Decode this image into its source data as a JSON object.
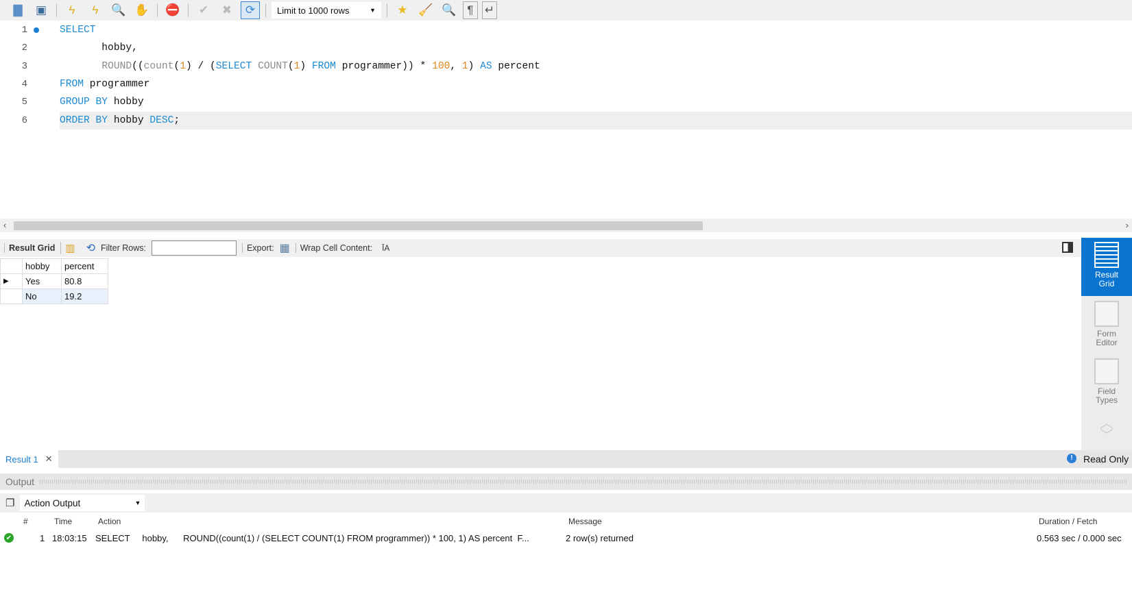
{
  "toolbar": {
    "limit_label": "Limit to 1000 rows",
    "icons": [
      "open-folder-icon",
      "save-icon",
      "execute-icon",
      "execute-current-icon",
      "explain-icon",
      "stop-icon",
      "toggle-error-icon",
      "commit-icon",
      "rollback-icon",
      "autocommit-icon",
      "add-snippet-icon",
      "beautify-icon",
      "find-icon",
      "invisible-chars-icon",
      "wrap-icon"
    ]
  },
  "editor": {
    "lines": [
      {
        "n": "1",
        "tokens": [
          {
            "t": "SELECT",
            "c": "kw"
          }
        ]
      },
      {
        "n": "2",
        "tokens": [
          {
            "t": "       hobby,",
            "c": "id"
          }
        ]
      },
      {
        "n": "3",
        "tokens": [
          {
            "t": "       ",
            "c": "id"
          },
          {
            "t": "ROUND",
            "c": "fn"
          },
          {
            "t": "((",
            "c": "id"
          },
          {
            "t": "count",
            "c": "fn"
          },
          {
            "t": "(",
            "c": "id"
          },
          {
            "t": "1",
            "c": "num"
          },
          {
            "t": ") / (",
            "c": "id"
          },
          {
            "t": "SELECT",
            "c": "kw"
          },
          {
            "t": " ",
            "c": "id"
          },
          {
            "t": "COUNT",
            "c": "fn"
          },
          {
            "t": "(",
            "c": "id"
          },
          {
            "t": "1",
            "c": "num"
          },
          {
            "t": ") ",
            "c": "id"
          },
          {
            "t": "FROM",
            "c": "kw"
          },
          {
            "t": " programmer)) * ",
            "c": "id"
          },
          {
            "t": "100",
            "c": "num"
          },
          {
            "t": ", ",
            "c": "id"
          },
          {
            "t": "1",
            "c": "num"
          },
          {
            "t": ") ",
            "c": "id"
          },
          {
            "t": "AS",
            "c": "kw"
          },
          {
            "t": " percent",
            "c": "id"
          }
        ]
      },
      {
        "n": "4",
        "tokens": [
          {
            "t": "FROM",
            "c": "kw"
          },
          {
            "t": " programmer",
            "c": "id"
          }
        ]
      },
      {
        "n": "5",
        "tokens": [
          {
            "t": "GROUP BY",
            "c": "kw"
          },
          {
            "t": " hobby",
            "c": "id"
          }
        ]
      },
      {
        "n": "6",
        "tokens": [
          {
            "t": "ORDER BY",
            "c": "kw"
          },
          {
            "t": " hobby ",
            "c": "id"
          },
          {
            "t": "DESC",
            "c": "kw"
          },
          {
            "t": ";",
            "c": "id"
          }
        ]
      }
    ]
  },
  "results": {
    "result_grid_label": "Result Grid",
    "filter_label": "Filter Rows:",
    "filter_value": "",
    "export_label": "Export:",
    "wrap_label": "Wrap Cell Content:",
    "columns": [
      "hobby",
      "percent"
    ],
    "rows": [
      [
        "Yes",
        "80.8"
      ],
      [
        "No",
        "19.2"
      ]
    ]
  },
  "side_panel": {
    "result_grid": [
      "Result",
      "Grid"
    ],
    "form_editor": [
      "Form",
      "Editor"
    ],
    "field_types": [
      "Field",
      "Types"
    ]
  },
  "result_tabs": {
    "tab": "Result 1",
    "status": "Read Only"
  },
  "output": {
    "title": "Output",
    "selector": "Action Output",
    "columns": [
      "#",
      "Time",
      "Action",
      "Message",
      "Duration / Fetch"
    ],
    "rows": [
      {
        "num": "1",
        "time": "18:03:15",
        "action": "SELECT     hobby,      ROUND((count(1) / (SELECT COUNT(1) FROM programmer)) * 100, 1) AS percent  F...",
        "message": "2 row(s) returned",
        "duration": "0.563 sec / 0.000 sec",
        "status": "success"
      }
    ]
  },
  "colors": {
    "keyword": "#1a8ad4",
    "function": "#8a8a8a",
    "number": "#e0861a",
    "accent": "#0a74d1",
    "success": "#2aa52a"
  }
}
